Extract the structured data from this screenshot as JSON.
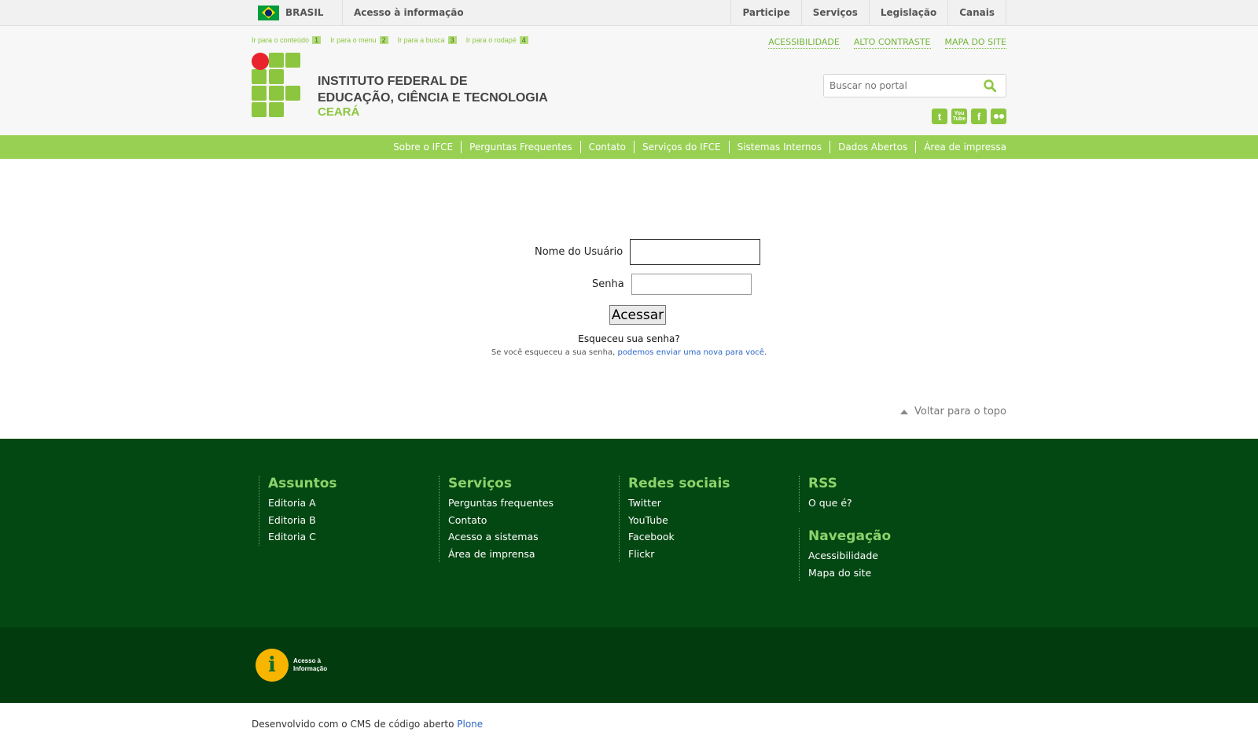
{
  "top_bar": {
    "country": "BRASIL",
    "access_info": "Acesso à informação",
    "links": [
      "Participe",
      "Serviços",
      "Legislação",
      "Canais"
    ]
  },
  "header": {
    "access_links": [
      {
        "label": "Ir para o conteúdo",
        "num": "1"
      },
      {
        "label": "Ir para o menu",
        "num": "2"
      },
      {
        "label": "Ir para a busca",
        "num": "3"
      },
      {
        "label": "Ir para o rodapé",
        "num": "4"
      }
    ],
    "utility_links": [
      "ACESSIBILIDADE",
      "ALTO CONTRASTE",
      "MAPA DO SITE"
    ],
    "title_line1": "INSTITUTO FEDERAL DE",
    "title_line2": "EDUCAÇÃO, CIÊNCIA E TECNOLOGIA",
    "subtitle": "CEARÁ",
    "search_placeholder": "Buscar no portal",
    "social_icons": [
      "twitter-icon",
      "youtube-icon",
      "facebook-icon",
      "flickr-icon"
    ]
  },
  "nav": {
    "items": [
      "Sobre o IFCE",
      "Perguntas Frequentes",
      "Contato",
      "Serviços do IFCE",
      "Sistemas Internos",
      "Dados Abertos",
      "Área de impressa"
    ]
  },
  "login": {
    "username_label": "Nome do Usuário",
    "password_label": "Senha",
    "submit_label": "Acessar",
    "forgot_title": "Esqueceu sua senha?",
    "forgot_text": "Se você esqueceu a sua senha, ",
    "forgot_link": "podemos enviar uma nova para você",
    "forgot_end": ".",
    "back_to_top": "Voltar para o topo"
  },
  "footer": {
    "columns": [
      {
        "title": "Assuntos",
        "links": [
          "Editoria A",
          "Editoria B",
          "Editoria C"
        ]
      },
      {
        "title": "Serviços",
        "links": [
          "Perguntas frequentes",
          "Contato",
          "Acesso a sistemas",
          "Área de imprensa"
        ]
      },
      {
        "title": "Redes sociais",
        "links": [
          "Twitter",
          "YouTube",
          "Facebook",
          "Flickr"
        ]
      },
      {
        "title": "RSS",
        "links": [
          "O que é?"
        ]
      },
      {
        "title": "Navegação",
        "links": [
          "Acessibilidade",
          "Mapa do site"
        ]
      }
    ],
    "ai_logo_line1": "Acesso à",
    "ai_logo_line2": "Informação",
    "credit_text": "Desenvolvido com o CMS de código aberto ",
    "credit_link": "Plone"
  },
  "colors": {
    "green_nav": "#98d053",
    "logo_green": "#8cc63f",
    "logo_red": "#e8232e",
    "footer_dark": "#034712"
  }
}
